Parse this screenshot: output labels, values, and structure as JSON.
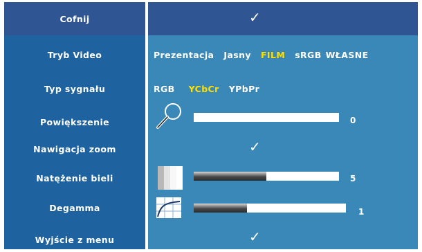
{
  "menu": {
    "back_label": "Cofnij",
    "video_mode": {
      "label": "Tryb Video",
      "options": [
        "Prezentacja",
        "Jasny",
        "FILM",
        "sRGB",
        "WŁASNE"
      ],
      "selected": "FILM"
    },
    "signal_type": {
      "label": "Typ sygnału",
      "options": [
        "RGB",
        "YCbCr",
        "YPbPr"
      ],
      "selected": "YCbCr"
    },
    "zoom": {
      "label": "Powiększenie",
      "value": "0",
      "level": 0
    },
    "zoom_navigation": {
      "label": "Nawigacja zoom"
    },
    "white_intensity": {
      "label": "Natężenie bieli",
      "value": "5",
      "level": 0.5
    },
    "degamma": {
      "label": "Degamma",
      "value": "1",
      "level": 0.35
    },
    "exit_label": "Wyjście z menu"
  },
  "colors": {
    "label_column": "#1e62a0",
    "value_column": "#3a88b8",
    "header_row": "#2f5593",
    "selected_option": "#ffe000"
  }
}
